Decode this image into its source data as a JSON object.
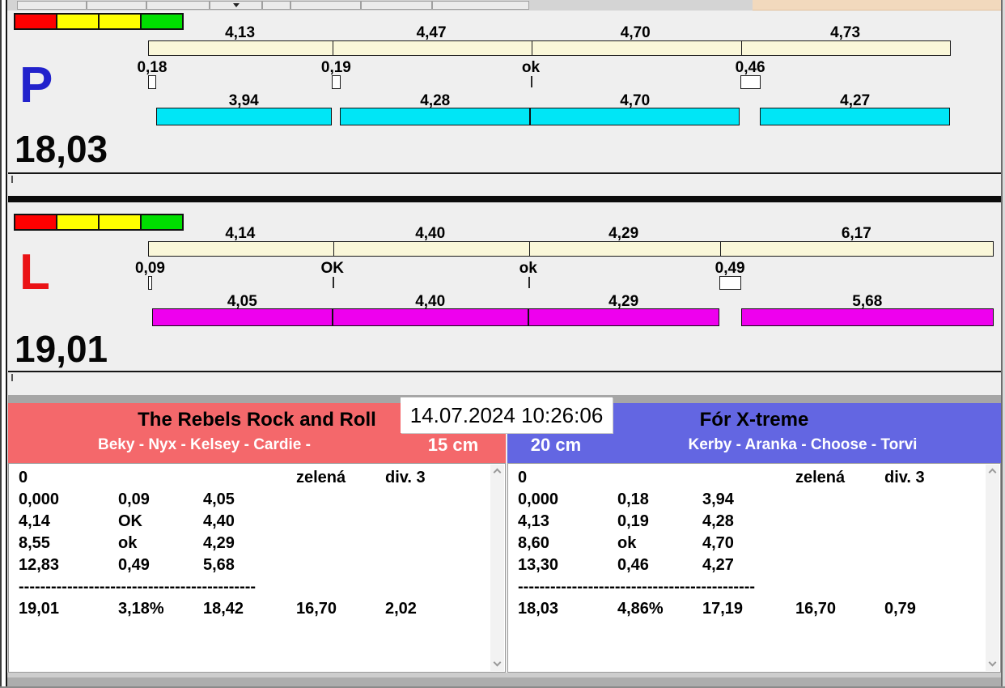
{
  "panels": [
    {
      "letter": "P",
      "letter_color": "#2222cc",
      "total": "18,03",
      "run_bar_color": "#00e6f6",
      "traffic_lights": [
        "#ff0000",
        "#ffff00",
        "#ffff00",
        "#00df00"
      ],
      "splits": [
        {
          "label": "4,13",
          "seconds": 4.13
        },
        {
          "label": "4,47",
          "seconds": 4.47
        },
        {
          "label": "4,70",
          "seconds": 4.7
        },
        {
          "label": "4,73",
          "seconds": 4.73
        }
      ],
      "exchanges": [
        {
          "label": "0,18",
          "seconds": 0.18,
          "ok": false
        },
        {
          "label": "0,19",
          "seconds": 0.19,
          "ok": false
        },
        {
          "label": "ok",
          "seconds": 0,
          "ok": true
        },
        {
          "label": "0,46",
          "seconds": 0.46,
          "ok": false
        }
      ],
      "runs": [
        {
          "label": "3,94",
          "seconds": 3.94
        },
        {
          "label": "4,28",
          "seconds": 4.28
        },
        {
          "label": "4,70",
          "seconds": 4.7
        },
        {
          "label": "4,27",
          "seconds": 4.27
        }
      ]
    },
    {
      "letter": "L",
      "letter_color": "#ea1215",
      "total": "19,01",
      "run_bar_color": "#ee00ee",
      "traffic_lights": [
        "#ff0000",
        "#ffff00",
        "#ffff00",
        "#00df00"
      ],
      "splits": [
        {
          "label": "4,14",
          "seconds": 4.14
        },
        {
          "label": "4,40",
          "seconds": 4.4
        },
        {
          "label": "4,29",
          "seconds": 4.29
        },
        {
          "label": "6,17",
          "seconds": 6.17
        }
      ],
      "exchanges": [
        {
          "label": "0,09",
          "seconds": 0.09,
          "ok": false
        },
        {
          "label": "OK",
          "seconds": 0,
          "ok": true
        },
        {
          "label": "ok",
          "seconds": 0,
          "ok": true
        },
        {
          "label": "0,49",
          "seconds": 0.49,
          "ok": false
        }
      ],
      "runs": [
        {
          "label": "4,05",
          "seconds": 4.05
        },
        {
          "label": "4,40",
          "seconds": 4.4
        },
        {
          "label": "4,29",
          "seconds": 4.29
        },
        {
          "label": "5,68",
          "seconds": 5.68
        }
      ]
    }
  ],
  "scoreboard": {
    "datetime": "14.07.2024 10:26:06",
    "teams": [
      {
        "name": "The Rebels Rock and Roll",
        "members": "Beky - Nyx - Kelsey - Cardie -",
        "height": "15 cm",
        "header_color": "#f4686b",
        "table": {
          "status_row": [
            "0",
            "",
            "",
            "zelená",
            "div. 3"
          ],
          "leg_rows": [
            [
              "0,000",
              "0,09",
              "4,05",
              "",
              ""
            ],
            [
              "4,14",
              "OK",
              "4,40",
              "",
              ""
            ],
            [
              "8,55",
              "ok",
              "4,29",
              "",
              ""
            ],
            [
              "12,83",
              "0,49",
              "5,68",
              "",
              ""
            ]
          ],
          "separator": "--------------------------------------------",
          "totals_row": [
            "19,01",
            "3,18%",
            "18,42",
            "16,70",
            "2,02"
          ]
        }
      },
      {
        "name": "Fór X-treme",
        "members": "Kerby - Aranka - Choose - Torvi",
        "height": "20 cm",
        "header_color": "#6366e2",
        "table": {
          "status_row": [
            "0",
            "",
            "",
            "zelená",
            "div. 3"
          ],
          "leg_rows": [
            [
              "0,000",
              "0,18",
              "3,94",
              "",
              ""
            ],
            [
              "4,13",
              "0,19",
              "4,28",
              "",
              ""
            ],
            [
              "8,60",
              "ok",
              "4,70",
              "",
              ""
            ],
            [
              "13,30",
              "0,46",
              "4,27",
              "",
              ""
            ]
          ],
          "separator": "--------------------------------------------",
          "totals_row": [
            "18,03",
            "4,86%",
            "17,19",
            "16,70",
            "0,79"
          ]
        }
      }
    ]
  }
}
